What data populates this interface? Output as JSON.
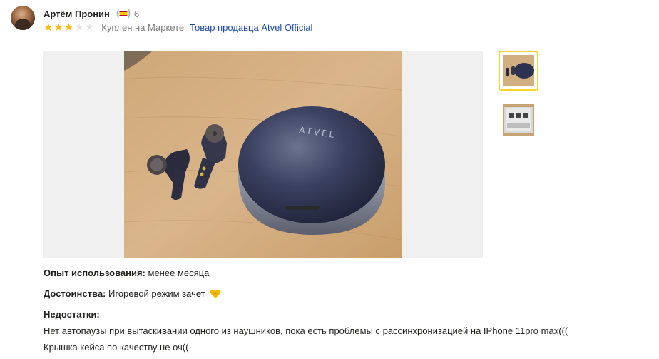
{
  "author": {
    "name": "Артём Пронин",
    "badge_count": "6"
  },
  "review": {
    "rating": 3,
    "rating_max": 5,
    "bought_label": "Куплен на Маркете",
    "seller_link": "Товар продавца Atvel Official"
  },
  "photo": {
    "case_brand": "ATVEL"
  },
  "fields": {
    "experience_label": "Опыт использования:",
    "experience_value": "менее месяца",
    "pros_label": "Достоинства:",
    "pros_value": "Игоревой режим зачет",
    "cons_label": "Недостатки:",
    "cons_lines": [
      "Нет автопаузы при вытаскивании одного из наушников, пока есть проблемы с рассинхронизацией на IPhone 11pro max(((",
      "Крышка кейса по качеству не оч(("
    ]
  },
  "icons": {
    "avatar": "user-avatar",
    "badge": "laurel-flag-badge-icon",
    "star": "star-icon",
    "pros_emoji": "heart-hands-emoji-icon"
  },
  "colors": {
    "star_on": "#ffb800",
    "star_off": "#e5e5e5",
    "link": "#1f4aa5",
    "thumb_active_border": "#fed42b"
  }
}
